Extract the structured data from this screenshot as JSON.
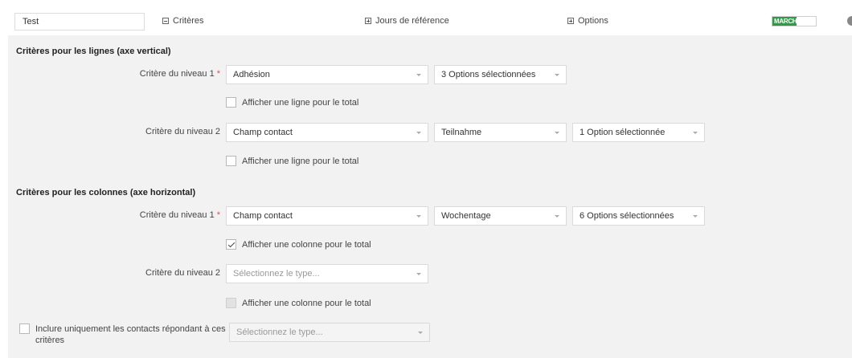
{
  "header": {
    "name_value": "Test",
    "toggles": {
      "criteres": "Critères",
      "jours": "Jours de référence",
      "options": "Options"
    },
    "status_label": "MARCH",
    "status_fill_percent": 55
  },
  "rows_section": {
    "title": "Critères pour les lignes (axe vertical)",
    "level1": {
      "label": "Critère du niveau 1",
      "required_mark": "*",
      "type": "Adhésion",
      "options": "3 Options sélectionnées",
      "total_label": "Afficher une ligne pour le total",
      "total_checked": false
    },
    "level2": {
      "label": "Critère du niveau 2",
      "type": "Champ contact",
      "field": "Teilnahme",
      "options": "1 Option sélectionnée",
      "total_label": "Afficher une ligne pour le total",
      "total_checked": false
    }
  },
  "columns_section": {
    "title": "Critères pour les colonnes (axe horizontal)",
    "level1": {
      "label": "Critère du niveau 1",
      "required_mark": "*",
      "type": "Champ contact",
      "field": "Wochentage",
      "options": "6 Options sélectionnées",
      "total_label": "Afficher une colonne pour le total",
      "total_checked": true
    },
    "level2": {
      "label": "Critère du niveau 2",
      "placeholder": "Sélectionnez le type...",
      "total_label": "Afficher une colonne pour le total",
      "total_checked": false
    }
  },
  "include_only": {
    "label": "Inclure uniquement les contacts répondant à ces critères",
    "placeholder": "Sélectionnez le type...",
    "checked": false
  },
  "colors": {
    "status_green": "#2e9b45",
    "required_red": "#d9534f",
    "panel_bg": "#f2f2f2"
  }
}
